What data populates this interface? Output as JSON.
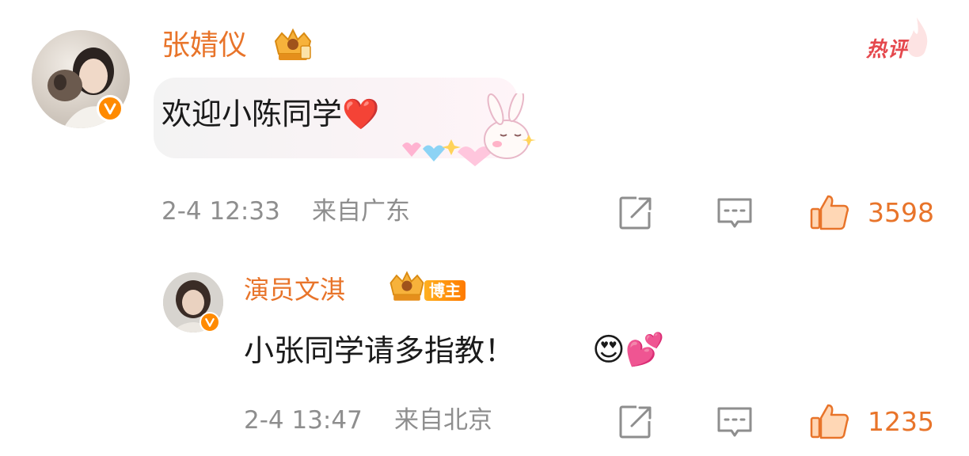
{
  "comments": [
    {
      "username": "张婧仪",
      "text": "欢迎小陈同学❤️",
      "time": "2-4 12:33",
      "location": "来自广东",
      "likes": "3598",
      "badge_label": "热评",
      "avatar_icon": "avatar-photo-icon",
      "verified_icon": "v-verified-icon",
      "vip_icon": "crown-vip-icon",
      "sticker_icon": "bunny-hearts-sticker-icon"
    },
    {
      "username": "演员文淇",
      "text": "小张同学请多指教！",
      "emoji": "😍💕",
      "time": "2-4 13:47",
      "location": "来自北京",
      "likes": "1235",
      "tag_label": "博主",
      "avatar_icon": "avatar-photo-icon",
      "verified_icon": "v-verified-icon",
      "vip_icon": "crown-vip-icon"
    }
  ],
  "colors": {
    "accent": "#e8742a",
    "verified": "#ff8a00",
    "hot": "#e5484d",
    "meta": "#8e8e8e"
  },
  "icons": {
    "share": "share-icon",
    "reply": "comment-icon",
    "like": "thumbs-up-icon"
  }
}
